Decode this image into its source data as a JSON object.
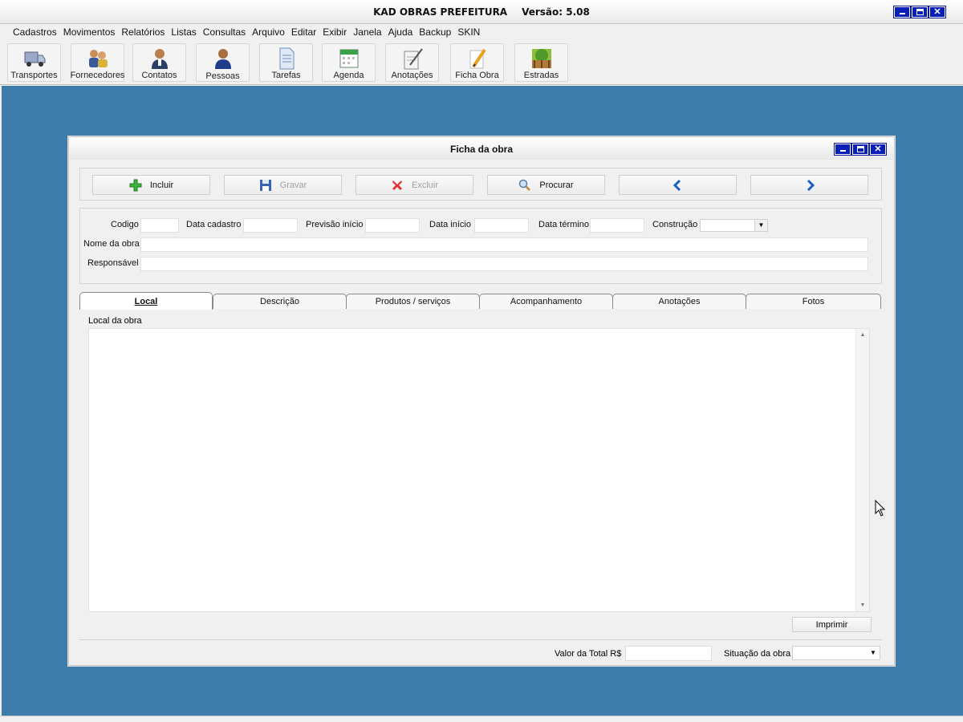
{
  "app": {
    "title": "KAD OBRAS PREFEITURA",
    "version": "Versão: 5.08",
    "window_buttons": [
      "minimize-icon",
      "maximize-icon",
      "close-icon"
    ]
  },
  "menu": [
    "Cadastros",
    "Movimentos",
    "Relatórios",
    "Listas",
    "Consultas",
    "Arquivo",
    "Editar",
    "Exibir",
    "Janela",
    "Ajuda",
    "Backup",
    "SKIN"
  ],
  "toolbar": [
    {
      "label": "Transportes",
      "icon": "truck-icon"
    },
    {
      "label": "Fornecedores",
      "icon": "suppliers-icon"
    },
    {
      "label": "Contatos",
      "icon": "contact-person-icon"
    },
    {
      "label": "Pessoas",
      "icon": "person-icon"
    },
    {
      "label": "Tarefas",
      "icon": "document-icon"
    },
    {
      "label": "Agenda",
      "icon": "calendar-icon"
    },
    {
      "label": "Anotações",
      "icon": "notepad-pen-icon"
    },
    {
      "label": "Ficha Obra",
      "icon": "pencil-icon"
    },
    {
      "label": "Estradas",
      "icon": "landscape-icon"
    }
  ],
  "ficha": {
    "title": "Ficha da obra",
    "actions": [
      {
        "label": "Incluir",
        "icon": "plus-icon",
        "enabled": true
      },
      {
        "label": "Gravar",
        "icon": "floppy-disk-icon",
        "enabled": false
      },
      {
        "label": "Excluir",
        "icon": "red-x-icon",
        "enabled": false
      },
      {
        "label": "Procurar",
        "icon": "magnifier-icon",
        "enabled": true
      },
      {
        "label": "",
        "icon": "arrow-left-icon",
        "enabled": true
      },
      {
        "label": "",
        "icon": "arrow-right-icon",
        "enabled": true
      }
    ],
    "fields": {
      "codigo": {
        "label": "Codigo",
        "value": ""
      },
      "data_cadastro": {
        "label": "Data cadastro",
        "value": ""
      },
      "previsao_inicio": {
        "label": "Previsão início",
        "value": ""
      },
      "data_inicio": {
        "label": "Data início",
        "value": ""
      },
      "data_termino": {
        "label": "Data término",
        "value": ""
      },
      "construcao": {
        "label": "Construção",
        "value": ""
      },
      "nome_da_obra": {
        "label": "Nome da obra",
        "value": ""
      },
      "responsavel": {
        "label": "Responsável",
        "value": ""
      }
    },
    "tabs": [
      "Local",
      "Descrição",
      "Produtos / serviços",
      "Acompanhamento",
      "Anotações",
      "Fotos"
    ],
    "active_tab": "Local",
    "local": {
      "label": "Local da obra",
      "value": ""
    },
    "print_button": "Imprimir",
    "footer": {
      "total_label": "Valor da Total R$",
      "total_value": "",
      "situacao_label": "Situação da obra",
      "situacao_value": ""
    }
  },
  "colors": {
    "desktop": "#3e7dab",
    "window_button": "#0a1fb8",
    "surface": "#f0f0f0"
  }
}
